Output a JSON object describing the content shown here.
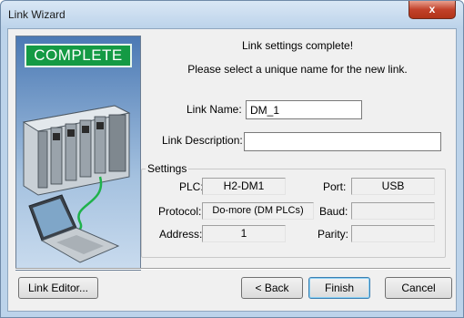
{
  "window": {
    "title": "Link Wizard",
    "close_glyph": "x"
  },
  "banner": {
    "label": "COMPLETE"
  },
  "main": {
    "heading": "Link settings complete!",
    "instruction": "Please select a unique name for the new link.",
    "link_name": {
      "label": "Link Name:",
      "value": "DM_1"
    },
    "link_description": {
      "label": "Link Description:",
      "value": ""
    }
  },
  "settings": {
    "title": "Settings",
    "plc": {
      "label": "PLC:",
      "value": "H2-DM1"
    },
    "port": {
      "label": "Port:",
      "value": "USB"
    },
    "protocol": {
      "label": "Protocol:",
      "value": "Do-more (DM PLCs)"
    },
    "baud": {
      "label": "Baud:",
      "value": ""
    },
    "address": {
      "label": "Address:",
      "value": "1"
    },
    "parity": {
      "label": "Parity:",
      "value": ""
    }
  },
  "buttons": {
    "link_editor": "Link Editor...",
    "back": "< Back",
    "finish": "Finish",
    "cancel": "Cancel"
  },
  "colors": {
    "title_bar": "#bcd3ea",
    "close_button": "#c2412a",
    "banner_green": "#149a44",
    "dialog_bg": "#f0f0f0"
  }
}
